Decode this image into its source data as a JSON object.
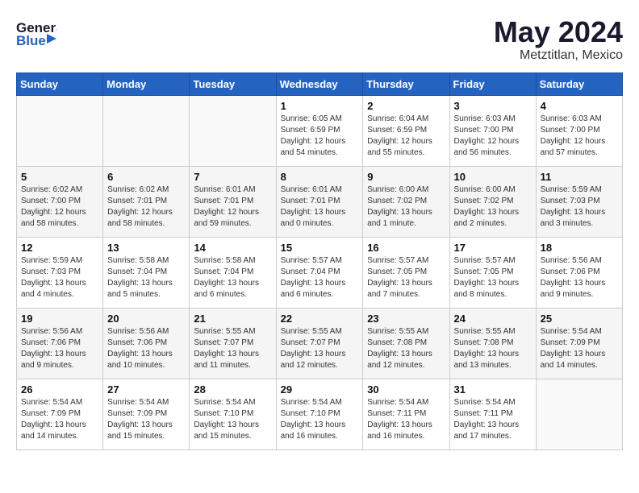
{
  "header": {
    "logo_general": "General",
    "logo_blue": "Blue",
    "month": "May 2024",
    "location": "Metztitlan, Mexico"
  },
  "weekdays": [
    "Sunday",
    "Monday",
    "Tuesday",
    "Wednesday",
    "Thursday",
    "Friday",
    "Saturday"
  ],
  "weeks": [
    [
      {
        "day": "",
        "info": ""
      },
      {
        "day": "",
        "info": ""
      },
      {
        "day": "",
        "info": ""
      },
      {
        "day": "1",
        "info": "Sunrise: 6:05 AM\nSunset: 6:59 PM\nDaylight: 12 hours\nand 54 minutes."
      },
      {
        "day": "2",
        "info": "Sunrise: 6:04 AM\nSunset: 6:59 PM\nDaylight: 12 hours\nand 55 minutes."
      },
      {
        "day": "3",
        "info": "Sunrise: 6:03 AM\nSunset: 7:00 PM\nDaylight: 12 hours\nand 56 minutes."
      },
      {
        "day": "4",
        "info": "Sunrise: 6:03 AM\nSunset: 7:00 PM\nDaylight: 12 hours\nand 57 minutes."
      }
    ],
    [
      {
        "day": "5",
        "info": "Sunrise: 6:02 AM\nSunset: 7:00 PM\nDaylight: 12 hours\nand 58 minutes."
      },
      {
        "day": "6",
        "info": "Sunrise: 6:02 AM\nSunset: 7:01 PM\nDaylight: 12 hours\nand 58 minutes."
      },
      {
        "day": "7",
        "info": "Sunrise: 6:01 AM\nSunset: 7:01 PM\nDaylight: 12 hours\nand 59 minutes."
      },
      {
        "day": "8",
        "info": "Sunrise: 6:01 AM\nSunset: 7:01 PM\nDaylight: 13 hours\nand 0 minutes."
      },
      {
        "day": "9",
        "info": "Sunrise: 6:00 AM\nSunset: 7:02 PM\nDaylight: 13 hours\nand 1 minute."
      },
      {
        "day": "10",
        "info": "Sunrise: 6:00 AM\nSunset: 7:02 PM\nDaylight: 13 hours\nand 2 minutes."
      },
      {
        "day": "11",
        "info": "Sunrise: 5:59 AM\nSunset: 7:03 PM\nDaylight: 13 hours\nand 3 minutes."
      }
    ],
    [
      {
        "day": "12",
        "info": "Sunrise: 5:59 AM\nSunset: 7:03 PM\nDaylight: 13 hours\nand 4 minutes."
      },
      {
        "day": "13",
        "info": "Sunrise: 5:58 AM\nSunset: 7:04 PM\nDaylight: 13 hours\nand 5 minutes."
      },
      {
        "day": "14",
        "info": "Sunrise: 5:58 AM\nSunset: 7:04 PM\nDaylight: 13 hours\nand 6 minutes."
      },
      {
        "day": "15",
        "info": "Sunrise: 5:57 AM\nSunset: 7:04 PM\nDaylight: 13 hours\nand 6 minutes."
      },
      {
        "day": "16",
        "info": "Sunrise: 5:57 AM\nSunset: 7:05 PM\nDaylight: 13 hours\nand 7 minutes."
      },
      {
        "day": "17",
        "info": "Sunrise: 5:57 AM\nSunset: 7:05 PM\nDaylight: 13 hours\nand 8 minutes."
      },
      {
        "day": "18",
        "info": "Sunrise: 5:56 AM\nSunset: 7:06 PM\nDaylight: 13 hours\nand 9 minutes."
      }
    ],
    [
      {
        "day": "19",
        "info": "Sunrise: 5:56 AM\nSunset: 7:06 PM\nDaylight: 13 hours\nand 9 minutes."
      },
      {
        "day": "20",
        "info": "Sunrise: 5:56 AM\nSunset: 7:06 PM\nDaylight: 13 hours\nand 10 minutes."
      },
      {
        "day": "21",
        "info": "Sunrise: 5:55 AM\nSunset: 7:07 PM\nDaylight: 13 hours\nand 11 minutes."
      },
      {
        "day": "22",
        "info": "Sunrise: 5:55 AM\nSunset: 7:07 PM\nDaylight: 13 hours\nand 12 minutes."
      },
      {
        "day": "23",
        "info": "Sunrise: 5:55 AM\nSunset: 7:08 PM\nDaylight: 13 hours\nand 12 minutes."
      },
      {
        "day": "24",
        "info": "Sunrise: 5:55 AM\nSunset: 7:08 PM\nDaylight: 13 hours\nand 13 minutes."
      },
      {
        "day": "25",
        "info": "Sunrise: 5:54 AM\nSunset: 7:09 PM\nDaylight: 13 hours\nand 14 minutes."
      }
    ],
    [
      {
        "day": "26",
        "info": "Sunrise: 5:54 AM\nSunset: 7:09 PM\nDaylight: 13 hours\nand 14 minutes."
      },
      {
        "day": "27",
        "info": "Sunrise: 5:54 AM\nSunset: 7:09 PM\nDaylight: 13 hours\nand 15 minutes."
      },
      {
        "day": "28",
        "info": "Sunrise: 5:54 AM\nSunset: 7:10 PM\nDaylight: 13 hours\nand 15 minutes."
      },
      {
        "day": "29",
        "info": "Sunrise: 5:54 AM\nSunset: 7:10 PM\nDaylight: 13 hours\nand 16 minutes."
      },
      {
        "day": "30",
        "info": "Sunrise: 5:54 AM\nSunset: 7:11 PM\nDaylight: 13 hours\nand 16 minutes."
      },
      {
        "day": "31",
        "info": "Sunrise: 5:54 AM\nSunset: 7:11 PM\nDaylight: 13 hours\nand 17 minutes."
      },
      {
        "day": "",
        "info": ""
      }
    ]
  ]
}
